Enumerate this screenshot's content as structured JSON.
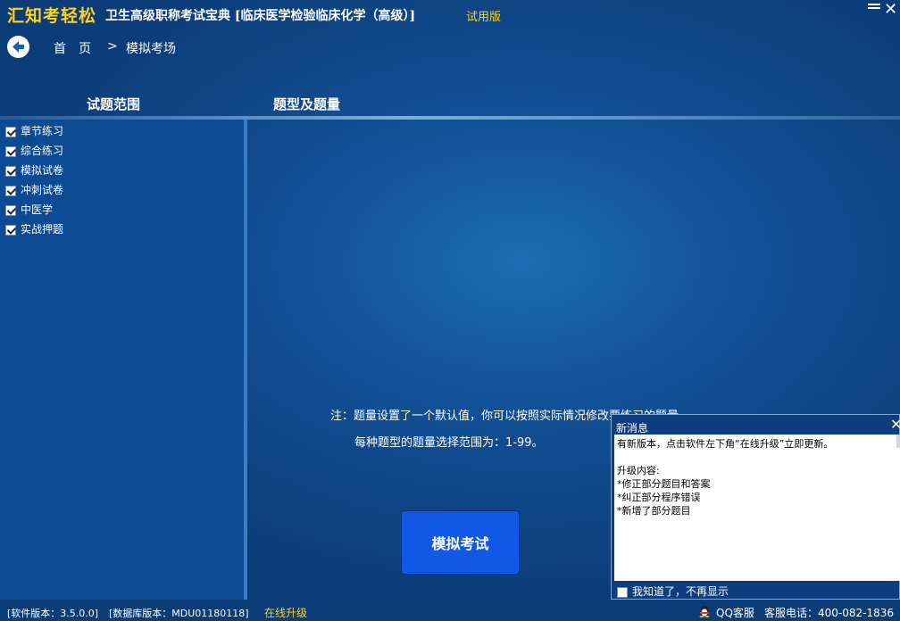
{
  "window": {
    "brand": "汇知考轻松",
    "product_title": "卫生高级职称考试宝典 [临床医学检验临床化学（高级）]",
    "trial_label": "试用版"
  },
  "nav": {
    "home": "首页",
    "separator": ">",
    "current": "模拟考场"
  },
  "headers": {
    "left": "试题范围",
    "right": "题型及题量"
  },
  "categories": [
    {
      "label": "章节练习",
      "checked": true
    },
    {
      "label": "综合练习",
      "checked": true
    },
    {
      "label": "模拟试卷",
      "checked": true
    },
    {
      "label": "冲刺试卷",
      "checked": true
    },
    {
      "label": "中医学",
      "checked": true
    },
    {
      "label": "实战押题",
      "checked": true
    }
  ],
  "notes": {
    "line1": "注：题量设置了一个默认值，你可以按照实际情况修改要练习的题量。",
    "line2": "每种题型的题量选择范围为：1-99。"
  },
  "start_button": "模拟考试",
  "popup": {
    "title": "新消息",
    "close": "✕",
    "lines": [
      "有新版本，点击软件左下角“在线升级”立即更新。",
      "",
      "升级内容:",
      "*修正部分题目和答案",
      "*纠正部分程序错误",
      "*新增了部分题目"
    ],
    "dont_show": "我知道了，不再显示"
  },
  "statusbar": {
    "software_version": "[软件版本：3.5.0.0]",
    "db_version": "[数据库版本：MDU01180118]",
    "online_upgrade": "在线升级",
    "qq_service": "QQ客服",
    "phone": "客服电话：400-082-1836"
  },
  "colors": {
    "accent_yellow": "#ffd21a",
    "button_blue": "#1158e6",
    "panel_blue": "#0c4a93"
  }
}
